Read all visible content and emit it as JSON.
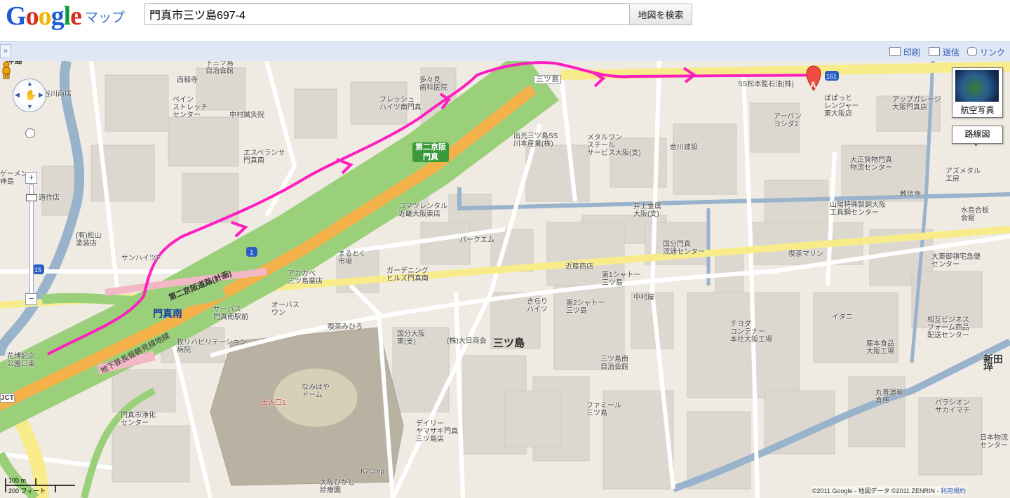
{
  "header": {
    "logo_letters": [
      "G",
      "o",
      "o",
      "g",
      "l",
      "e"
    ],
    "product": "マップ",
    "search_value": "門真市三ツ島697-4",
    "search_button": "地図を検索"
  },
  "toolbar": {
    "collapse": "»",
    "print": "印刷",
    "send": "送信",
    "link": "リンク"
  },
  "map": {
    "controls": {
      "zoom_in": "+",
      "zoom_out": "−",
      "satellite": "航空写真",
      "map_type": "路線図",
      "scale_metric": "100 m",
      "scale_imperial": "200 フィート"
    },
    "copyright": {
      "text": "©2011 Google - 地図データ ©2011 ZENRIN - ",
      "terms_link": "利用規約"
    },
    "marker_letter": "A",
    "route_color": "#ff1fc0",
    "highway_color": "#9bd07a",
    "labels": {
      "area_main": "三ツ島",
      "station": "門真南",
      "interchange": "第二京阪\n門真",
      "subway_line": "地下鉄長堀鶴見線地線",
      "planned_road": "第二京阪道路(計画)",
      "pois": [
        "神島",
        "谷川商店",
        "西稲寺",
        "ペイン\nストレッチ\nセンター",
        "下三ツ島\n自治会館",
        "多々見\n歯科医院",
        "フレッシュ\nハイツ南門真",
        "中村鍼灸院",
        "エスペランサ\n門真南",
        "三ツ島",
        "SS松本監石油(株)",
        "ぱぱっと\nレンジャー\n東大阪店",
        "アップガレージ\n大阪門真店",
        "アーバン\nヨシダ2",
        "出光三ツ島SS\n川本産業(株)",
        "メタルワン\nスチール\nサービス大阪(支)",
        "金川建設",
        "大正貨物門真\n物流センター",
        "アズメタル\n工房",
        "教信寺",
        "山陽特殊製鋼大阪\n工具鋼センター",
        "水島合板\n会館",
        "井上金属\n大阪(支)",
        "コマツレンタル\n近畿大阪東店",
        "パークエム",
        "国分門真\n流通センター",
        "喫茶マリン",
        "大東御領宅急便\nセンター",
        "適作店",
        "(有)松山\n塗装店",
        "サンハイツF",
        "まるとく\n市場",
        "近藤商店",
        "第1シャトー\n三ツ島",
        "アカカベ\n三ツ島薬店",
        "ガーデニング\nヒルズ門真南",
        "きらり\nハイツ",
        "第2シャトー\n三ツ島",
        "中村屋",
        "オーバス\nワン",
        "サーパス\n門真南駅前",
        "喫茶みひろ",
        "国分大阪\n東(支)",
        "(株)大日商会",
        "チヨダ\nコンテナー\n本社大阪工場",
        "イタニ",
        "藤本食品\n大阪工場",
        "相互ビジネス\nフォーム商品\n配送センター",
        "新田埣",
        "牧リハビリテーション\n病院",
        "花博記念\n公園口東",
        "JCT",
        "なみはや\nドーム",
        "出入口1",
        "三ツ島南\n自治会館",
        "ファミール\n三ツ島",
        "デイリー\nヤマザキ門真\n三ツ島店",
        "丸善運輸\n倉庫",
        "パラシオン\nサカイマチ",
        "日本物流\nセンター",
        "門真市浄化\nセンター",
        "K2Corp",
        "大阪ひがし\n診療園",
        "ゲーメン\n神島"
      ]
    }
  }
}
